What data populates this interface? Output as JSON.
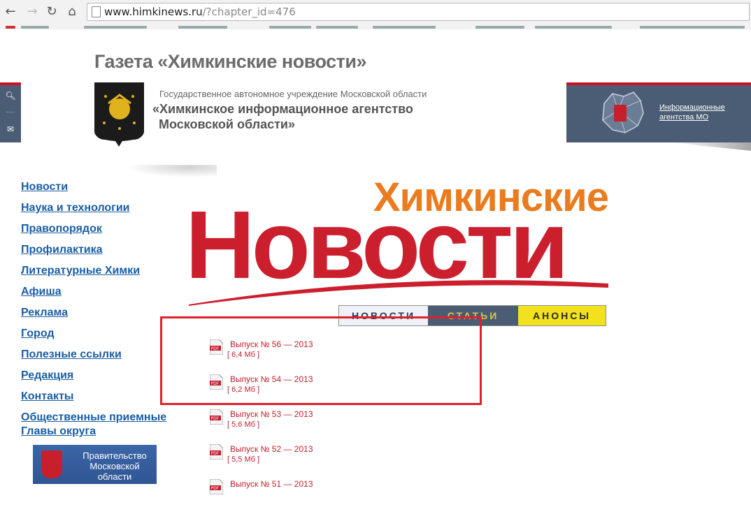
{
  "browser": {
    "url_host": "www.himkinews.ru",
    "url_path": "/?chapter_id=476",
    "back_icon": "back-arrow-icon",
    "forward_icon": "forward-arrow-icon",
    "reload_icon": "reload-icon",
    "home_icon": "home-icon"
  },
  "header": {
    "site_title": "Газета «Химкинские новости»",
    "gov_small": "Государственное автономное учреждение Московской области",
    "gov_line1": "«Химкинское информационное агентство",
    "gov_line2": "Московской области»",
    "info_link_line1": "Информационные",
    "info_link_line2": "агентства МО"
  },
  "left_tabs": {
    "search_icon": "search-icon",
    "mail_icon": "mail-icon"
  },
  "nav": {
    "items": [
      "Новости",
      "Наука и технологии",
      "Правопорядок",
      "Профилактика",
      "Литературные Химки",
      "Афиша",
      "Реклама",
      "Город",
      "Полезные ссылки",
      "Редакция",
      "Контакты"
    ],
    "last_item_line1": "Общественные приемные",
    "last_item_line2": "Главы округа"
  },
  "banner": {
    "line1": "Правительство",
    "line2": "Московской",
    "line3": "области"
  },
  "logo": {
    "top": "Химкинские",
    "big": "Новости"
  },
  "tabs": [
    "НОВОСТИ",
    "СТАТЬИ",
    "АНОНСЫ"
  ],
  "issues": [
    {
      "title": "Выпуск № 56 — 2013",
      "size": "[ 6,4 Мб ]"
    },
    {
      "title": "Выпуск № 54 — 2013",
      "size": "[ 6,2 Мб ]"
    },
    {
      "title": "Выпуск № 53 — 2013",
      "size": "[ 5,6 Мб ]"
    },
    {
      "title": "Выпуск № 52 — 2013",
      "size": "[ 5,5 Мб ]"
    },
    {
      "title": "Выпуск № 51 — 2013",
      "size": ""
    }
  ],
  "colors": {
    "accent_red": "#cc1f2e",
    "accent_orange": "#ea7b1e",
    "nav_blue": "#1a5ea3",
    "slate": "#4b5d74",
    "highlight_red": "#e0202a"
  }
}
